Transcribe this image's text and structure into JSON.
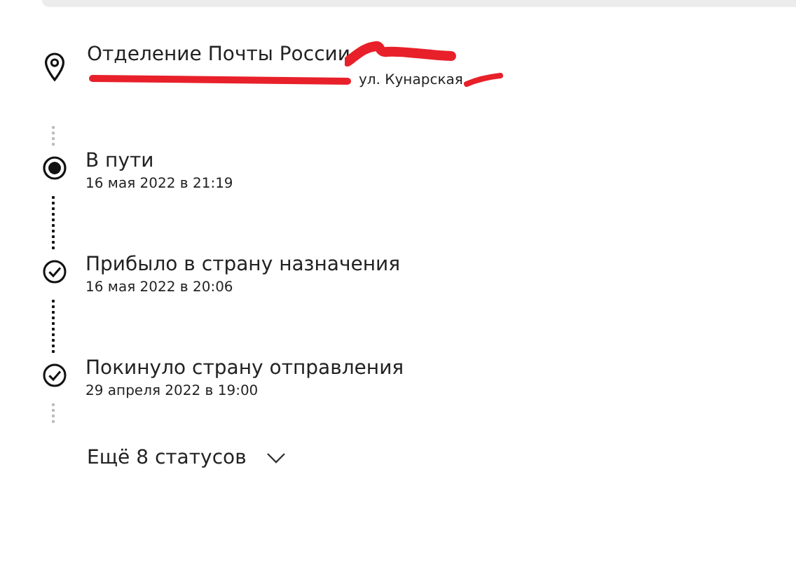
{
  "office": {
    "title": "Отделение Почты России",
    "address": "ул. Кунарская"
  },
  "statuses": [
    {
      "title": "В пути",
      "date": "16 мая 2022 в 21:19",
      "kind": "current"
    },
    {
      "title": "Прибыло в страну назначения",
      "date": "16 мая 2022 в 20:06",
      "kind": "done"
    },
    {
      "title": "Покинуло страну отправления",
      "date": "29 апреля 2022 в 19:00",
      "kind": "done"
    }
  ],
  "more_button": {
    "label": "Ещё 8 статусов"
  }
}
